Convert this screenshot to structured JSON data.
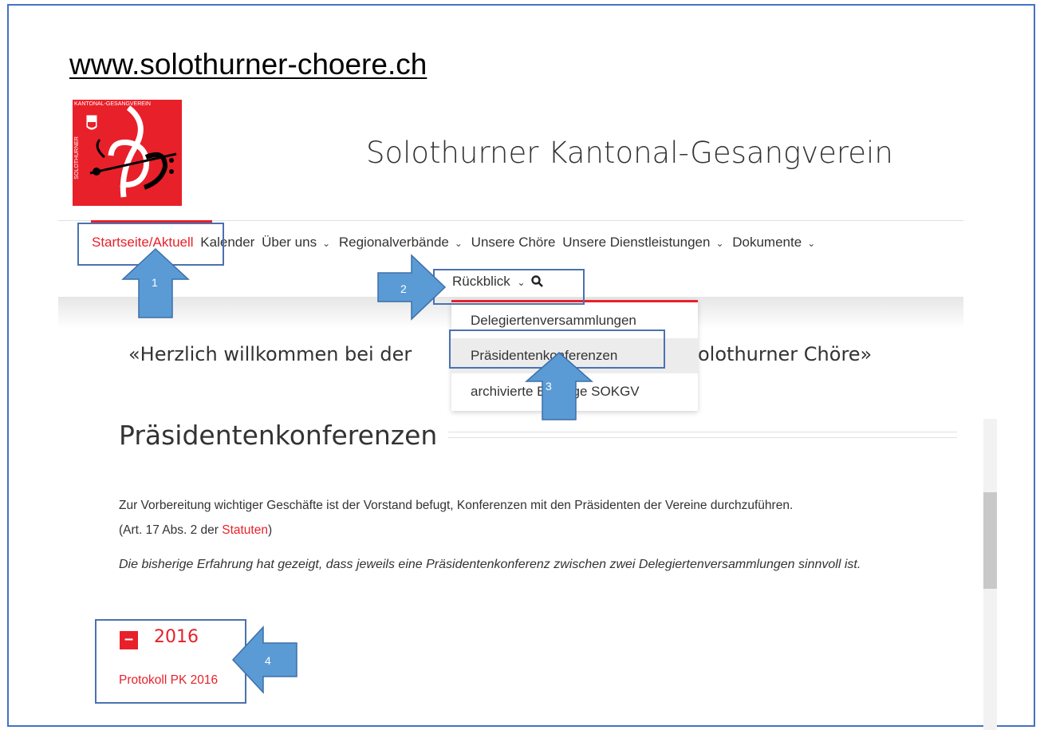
{
  "url": "www.solothurner-choere.ch",
  "logo": {
    "top_text": "KANTONAL-GESANGVEREIN",
    "side_text": "SOLOTHURNER"
  },
  "site_title": "Solothurner Kantonal-Gesangverein",
  "nav": {
    "items": [
      {
        "label": "Startseite/Aktuell",
        "active": true,
        "has_dropdown": false
      },
      {
        "label": "Kalender",
        "has_dropdown": false
      },
      {
        "label": "Über uns",
        "has_dropdown": true
      },
      {
        "label": "Regionalverbände",
        "has_dropdown": true
      },
      {
        "label": "Unsere Chöre",
        "has_dropdown": false
      },
      {
        "label": "Unsere Dienstleistungen",
        "has_dropdown": true
      },
      {
        "label": "Dokumente",
        "has_dropdown": true
      }
    ],
    "second_row": {
      "label": "Rückblick",
      "has_dropdown": true,
      "search_icon": "search-icon"
    }
  },
  "dropdown": {
    "items": [
      {
        "label": "Delegiertenversammlungen"
      },
      {
        "label": "Präsidentenkonferenzen",
        "highlighted": true
      },
      {
        "label": "archivierte Beiträge SOKGV"
      }
    ]
  },
  "welcome": {
    "left": "«Herzlich willkommen bei der",
    "right": "olothurner Chöre»"
  },
  "section_title": "Präsidentenkonferenzen",
  "paragraph1": {
    "line1": "Zur Vorbereitung wichtiger Geschäfte ist der Vorstand befugt, Konferenzen mit den Präsidenten der Vereine durchzuführen.",
    "line2_prefix": "(Art. 17 Abs. 2 der ",
    "line2_link": "Statuten",
    "line2_suffix": ")"
  },
  "paragraph2": "Die bisherige Erfahrung hat gezeigt, dass jeweils eine Präsidentenkonferenz zwischen zwei Delegiertenversammlungen sinnvoll ist.",
  "accordion": {
    "toggle": "–",
    "year": "2016",
    "link": "Protokoll PK 2016"
  },
  "annotations": {
    "a1": "1",
    "a2": "2",
    "a3": "3",
    "a4": "4"
  },
  "colors": {
    "accent": "#e8202a",
    "annotation": "#5b9bd5",
    "annotation_border": "#4a72b0"
  }
}
